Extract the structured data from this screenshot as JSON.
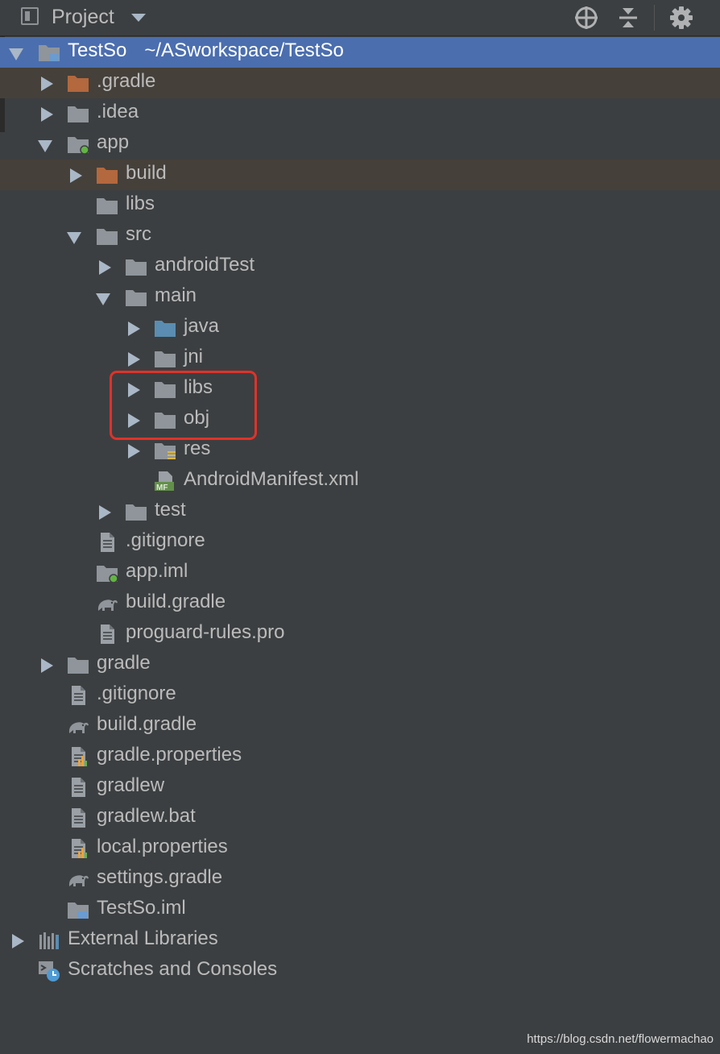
{
  "header": {
    "title": "Project"
  },
  "tree": [
    {
      "id": "root",
      "label": "TestSo",
      "path": "~/ASworkspace/TestSo",
      "state": "expanded",
      "icon": "module-folder-icon",
      "selected": true
    },
    {
      "id": "gradle-dir",
      "label": ".gradle",
      "state": "collapsed",
      "icon": "excluded-folder-icon",
      "excluded": true
    },
    {
      "id": "idea-dir",
      "label": ".idea",
      "state": "collapsed",
      "icon": "folder-icon"
    },
    {
      "id": "app-dir",
      "label": "app",
      "state": "expanded",
      "icon": "android-module-folder-icon"
    },
    {
      "id": "build-dir",
      "label": "build",
      "state": "collapsed",
      "icon": "excluded-folder-icon",
      "excluded": true
    },
    {
      "id": "app-libs-dir",
      "label": "libs",
      "state": "leaf",
      "icon": "folder-icon"
    },
    {
      "id": "src-dir",
      "label": "src",
      "state": "expanded",
      "icon": "folder-icon"
    },
    {
      "id": "androidtest-dir",
      "label": "androidTest",
      "state": "collapsed",
      "icon": "folder-icon"
    },
    {
      "id": "main-dir",
      "label": "main",
      "state": "expanded",
      "icon": "folder-icon"
    },
    {
      "id": "java-dir",
      "label": "java",
      "state": "collapsed",
      "icon": "source-folder-icon"
    },
    {
      "id": "jni-dir",
      "label": "jni",
      "state": "collapsed",
      "icon": "folder-icon"
    },
    {
      "id": "main-libs-dir",
      "label": "libs",
      "state": "collapsed",
      "icon": "folder-icon"
    },
    {
      "id": "obj-dir",
      "label": "obj",
      "state": "collapsed",
      "icon": "folder-icon"
    },
    {
      "id": "res-dir",
      "label": "res",
      "state": "collapsed",
      "icon": "resource-folder-icon"
    },
    {
      "id": "manifest-file",
      "label": "AndroidManifest.xml",
      "state": "leaf",
      "icon": "manifest-file-icon"
    },
    {
      "id": "test-dir",
      "label": "test",
      "state": "collapsed",
      "icon": "folder-icon"
    },
    {
      "id": "app-gitignore",
      "label": ".gitignore",
      "state": "leaf",
      "icon": "text-file-icon"
    },
    {
      "id": "app-iml",
      "label": "app.iml",
      "state": "leaf",
      "icon": "android-module-file-icon"
    },
    {
      "id": "app-build-gradle",
      "label": "build.gradle",
      "state": "leaf",
      "icon": "gradle-elephant-icon"
    },
    {
      "id": "proguard",
      "label": "proguard-rules.pro",
      "state": "leaf",
      "icon": "text-file-icon"
    },
    {
      "id": "gradle-folder",
      "label": "gradle",
      "state": "collapsed",
      "icon": "folder-icon"
    },
    {
      "id": "root-gitignore",
      "label": ".gitignore",
      "state": "leaf",
      "icon": "text-file-icon"
    },
    {
      "id": "root-build-gradle",
      "label": "build.gradle",
      "state": "leaf",
      "icon": "gradle-elephant-icon"
    },
    {
      "id": "gradle-properties",
      "label": "gradle.properties",
      "state": "leaf",
      "icon": "properties-file-icon"
    },
    {
      "id": "gradlew",
      "label": "gradlew",
      "state": "leaf",
      "icon": "text-file-icon"
    },
    {
      "id": "gradlew-bat",
      "label": "gradlew.bat",
      "state": "leaf",
      "icon": "text-file-icon"
    },
    {
      "id": "local-properties",
      "label": "local.properties",
      "state": "leaf",
      "icon": "properties-file-icon"
    },
    {
      "id": "settings-gradle",
      "label": "settings.gradle",
      "state": "leaf",
      "icon": "gradle-elephant-icon"
    },
    {
      "id": "testso-iml",
      "label": "TestSo.iml",
      "state": "leaf",
      "icon": "module-file-icon"
    },
    {
      "id": "external-libs",
      "label": "External Libraries",
      "state": "collapsed",
      "icon": "library-icon"
    },
    {
      "id": "scratches",
      "label": "Scratches and Consoles",
      "state": "leaf",
      "icon": "scratches-icon"
    }
  ],
  "watermark": "https://blog.csdn.net/flowermachao",
  "colors": {
    "background": "#3c3f41",
    "selection": "#4b6eaf",
    "excluded_row": "#45403a",
    "highlight_box": "#e0322a"
  }
}
